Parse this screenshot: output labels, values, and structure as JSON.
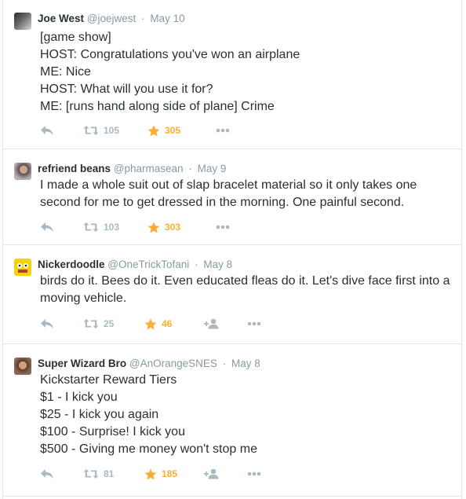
{
  "tweets": [
    {
      "name": "Joe West",
      "handle": "@joejwest",
      "time": "May 10",
      "text": "[game show]\nHOST: Congratulations you've won an airplane\nME: Nice\nHOST: What will you use it for?\nME: [runs hand along side of plane] Crime",
      "retweets": "105",
      "favorites": "305"
    },
    {
      "name": "refriend beans",
      "handle": "@pharmasean",
      "time": "May 9",
      "text": "I made a whole suit out of slap bracelet material so it only takes one\nsecond for me to get dressed in the morning. One painful second.",
      "retweets": "103",
      "favorites": "303"
    },
    {
      "name": "Nickerdoodle",
      "handle": "@OneTrickTofani",
      "time": "May 8",
      "text": "birds do it. Bees do it. Even educated fleas do it. Let's dive face first into a\nmoving vehicle.",
      "retweets": "25",
      "favorites": "46"
    },
    {
      "name": "Super Wizard Bro",
      "handle": "@AnOrangeSNES",
      "time": "May 8",
      "text": "Kickstarter Reward Tiers\n$1 - I kick you\n$25 - I kick you again\n$100 - Surprise! I kick you\n$500 - Giving me money won't stop me",
      "retweets": "81",
      "favorites": "185"
    }
  ],
  "separator": "·",
  "icons": {
    "reply": "reply-icon",
    "retweet": "retweet-icon",
    "favorite": "star-icon",
    "follow": "follow-icon",
    "more": "more-icon"
  },
  "colors": {
    "text": "#292f33",
    "muted": "#8899a6",
    "icon": "#aab8c2",
    "favorite": "#ffac33",
    "border": "#e1e8ed"
  }
}
